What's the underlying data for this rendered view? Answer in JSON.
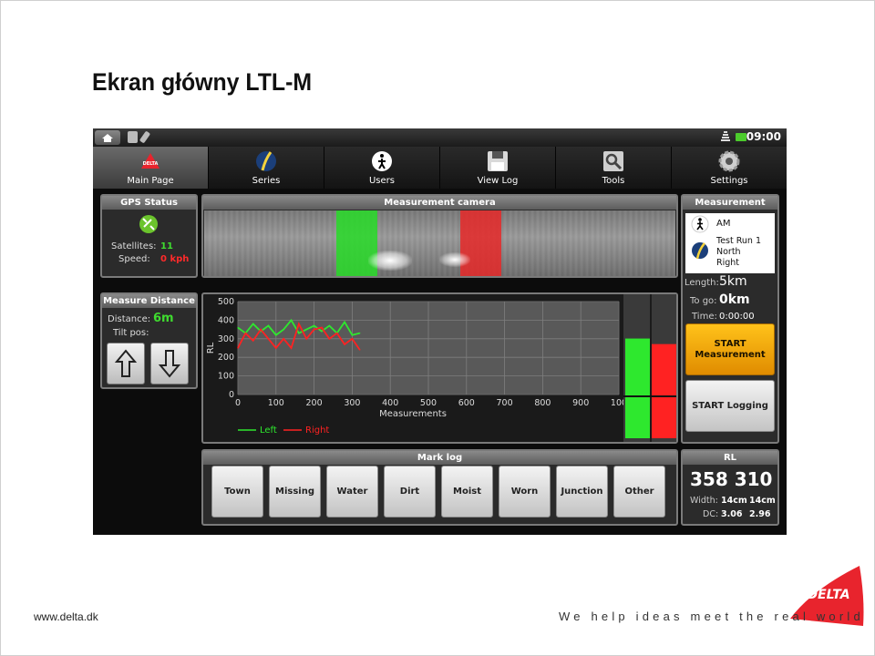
{
  "slide": {
    "title": "Ekran główny LTL-M",
    "footer_url": "www.delta.dk",
    "tagline": "We help ideas meet the real world",
    "logo_text": "DELTA"
  },
  "statusbar": {
    "time": "09:00"
  },
  "tabs": [
    {
      "label": "Main Page",
      "icon": "delta-logo-icon",
      "active": true
    },
    {
      "label": "Series",
      "icon": "road-icon",
      "active": false
    },
    {
      "label": "Users",
      "icon": "pedestrian-icon",
      "active": false
    },
    {
      "label": "View Log",
      "icon": "floppy-disk-icon",
      "active": false
    },
    {
      "label": "Tools",
      "icon": "magnifier-tool-icon",
      "active": false
    },
    {
      "label": "Settings",
      "icon": "gear-icon",
      "active": false
    }
  ],
  "gps": {
    "title": "GPS Status",
    "satellites_label": "Satellites:",
    "satellites_value": "11",
    "speed_label": "Speed:",
    "speed_value": "0 kph"
  },
  "measure_distance": {
    "title": "Measure Distance",
    "distance_label": "Distance:",
    "distance_value": "6m",
    "tilt_label": "Tilt pos:"
  },
  "camera": {
    "title": "Measurement camera"
  },
  "chart_data": {
    "type": "line",
    "ylabel": "RL",
    "xlabel": "Measurements",
    "xlim": [
      0,
      1000
    ],
    "ylim": [
      0,
      500
    ],
    "xticks": [
      0,
      100,
      200,
      300,
      400,
      500,
      600,
      700,
      800,
      900,
      1000
    ],
    "xtick_labels": [
      "0",
      "100",
      "200",
      "300",
      "400",
      "500",
      "600",
      "700",
      "800",
      "900",
      "100"
    ],
    "yticks": [
      0,
      100,
      200,
      300,
      400,
      500
    ],
    "grid": true,
    "legend_position": "bottom-left",
    "series": [
      {
        "name": "Left",
        "color": "#2ee82e",
        "x": [
          0,
          20,
          40,
          60,
          80,
          100,
          120,
          140,
          160,
          180,
          200,
          220,
          240,
          260,
          280,
          300,
          320
        ],
        "y": [
          360,
          330,
          380,
          340,
          370,
          320,
          350,
          400,
          330,
          350,
          370,
          340,
          370,
          330,
          390,
          320,
          330
        ]
      },
      {
        "name": "Right",
        "color": "#ff2222",
        "x": [
          0,
          20,
          40,
          60,
          80,
          100,
          120,
          140,
          160,
          180,
          200,
          220,
          240,
          260,
          280,
          300,
          320
        ],
        "y": [
          250,
          330,
          290,
          350,
          300,
          250,
          300,
          250,
          380,
          300,
          350,
          360,
          300,
          330,
          270,
          300,
          240
        ]
      }
    ],
    "level_bars": {
      "left_fraction": 0.72,
      "right_fraction": 0.68,
      "left_color": "#2ee82e",
      "right_color": "#ff2222"
    }
  },
  "measurement": {
    "title": "Measurement",
    "user": "AM",
    "series_line1": "Test Run 1",
    "series_line2": "North",
    "series_line3": "Right",
    "length_label": "Length:",
    "length_value": "5km",
    "togo_label": "To go:",
    "togo_value": "0km",
    "time_label": "Time:",
    "time_value": "0:00:00",
    "start_measurement_line1": "START",
    "start_measurement_line2": "Measurement",
    "start_logging": "START Logging"
  },
  "mark_log": {
    "title": "Mark log",
    "buttons": [
      "Town",
      "Missing",
      "Water",
      "Dirt",
      "Moist",
      "Worn",
      "Junction",
      "Other"
    ]
  },
  "rl": {
    "title": "RL",
    "value": "358 310",
    "width_label": "Width:",
    "width_left": "14cm",
    "width_right": "14cm",
    "dc_label": "DC:",
    "dc_left": "3.06",
    "dc_right": "2.96"
  }
}
